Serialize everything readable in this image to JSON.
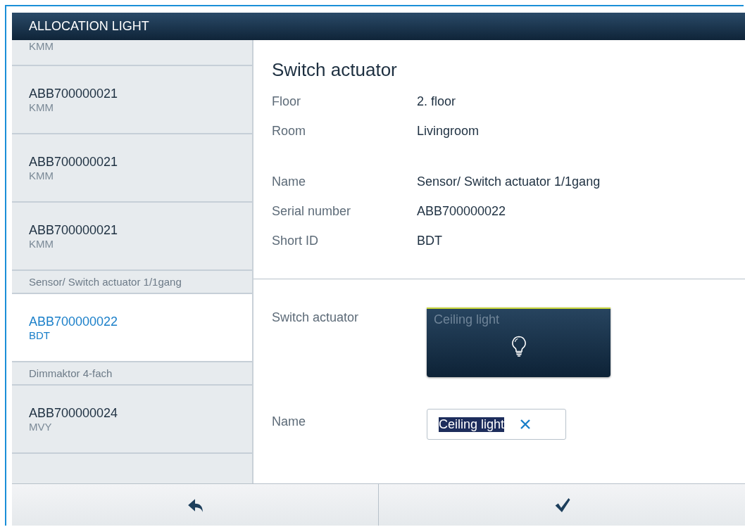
{
  "window": {
    "title": "ALLOCATION LIGHT"
  },
  "sidebar": {
    "items": [
      {
        "kind": "cut",
        "sub": "KMM",
        "selected": false
      },
      {
        "kind": "device",
        "serial": "ABB700000021",
        "sub": "KMM",
        "selected": false
      },
      {
        "kind": "device",
        "serial": "ABB700000021",
        "sub": "KMM",
        "selected": false
      },
      {
        "kind": "device",
        "serial": "ABB700000021",
        "sub": "KMM",
        "selected": false
      },
      {
        "kind": "group",
        "label": "Sensor/ Switch actuator 1/1gang"
      },
      {
        "kind": "device",
        "serial": "ABB700000022",
        "sub": "BDT",
        "selected": true
      },
      {
        "kind": "group",
        "label": "Dimmaktor 4-fach"
      },
      {
        "kind": "device",
        "serial": "ABB700000024",
        "sub": "MVY",
        "selected": false
      }
    ]
  },
  "detail": {
    "title": "Switch actuator",
    "location": [
      {
        "label": "Floor",
        "value": "2. floor"
      },
      {
        "label": "Room",
        "value": "Livingroom"
      }
    ],
    "info": [
      {
        "label": "Name",
        "value": "Sensor/ Switch actuator 1/1gang"
      },
      {
        "label": "Serial number",
        "value": "ABB700000022"
      },
      {
        "label": "Short ID",
        "value": "BDT"
      }
    ],
    "tile_label": "Switch actuator",
    "tile": {
      "text": "Ceiling light"
    },
    "name_label": "Name",
    "name_field": {
      "value": "Ceiling light",
      "text_selected": true
    }
  },
  "footer": {
    "buttons": [
      {
        "kind": "back"
      },
      {
        "kind": "confirm"
      }
    ]
  }
}
